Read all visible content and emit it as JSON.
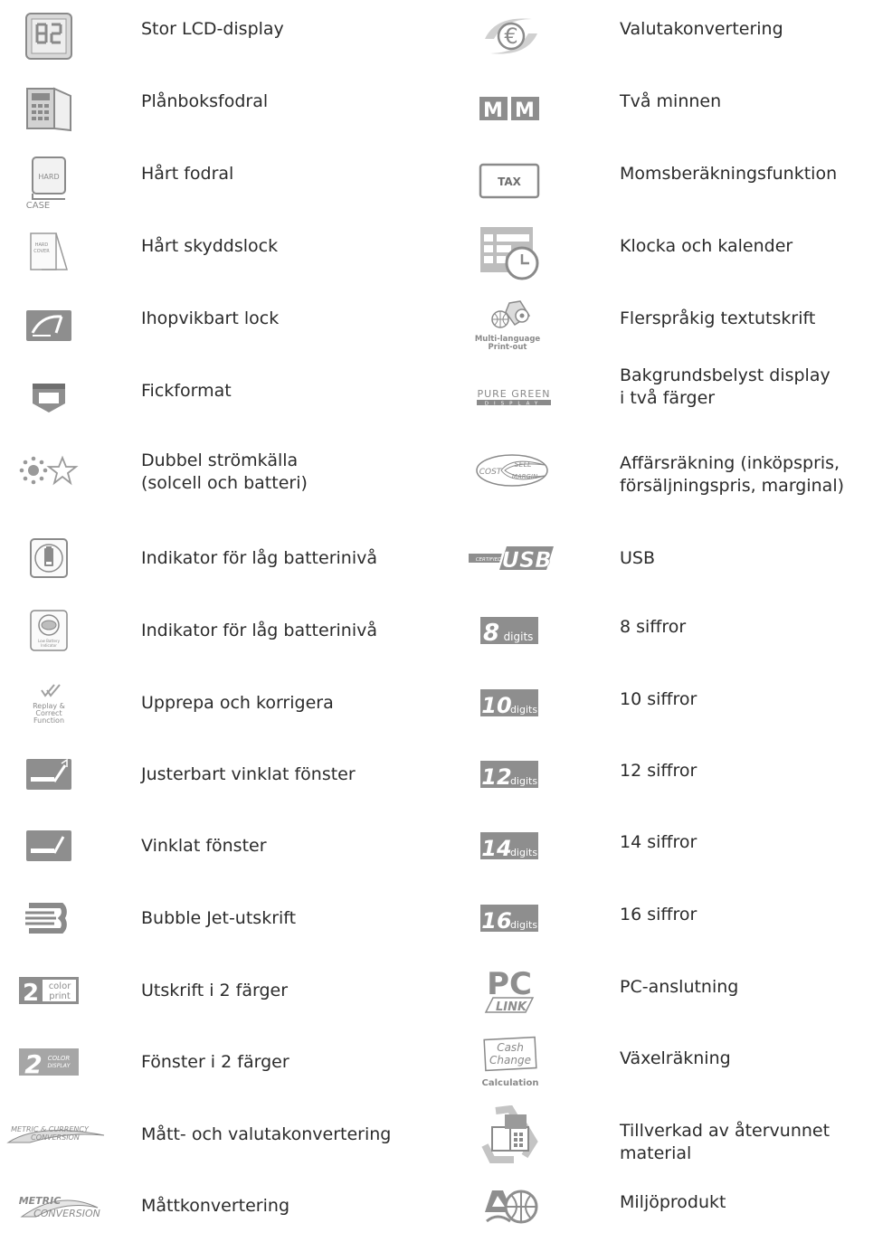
{
  "left_column": [
    {
      "label": "Stor LCD-display",
      "icon": "large-lcd-display-icon"
    },
    {
      "label": "Plånboksfodral",
      "icon": "wallet-case-icon"
    },
    {
      "label": "Hårt fodral",
      "icon": "hard-case-icon",
      "icon_text": [
        "HARD",
        "CASE"
      ]
    },
    {
      "label": "Hårt skyddslock",
      "icon": "hard-cover-icon",
      "icon_text": [
        "HARD",
        "COVER"
      ]
    },
    {
      "label": "Ihopvikbart lock",
      "icon": "folding-cover-icon"
    },
    {
      "label": "Fickformat",
      "icon": "pocket-size-icon"
    },
    {
      "label": "Dubbel strömkälla\n(solcell och batteri)",
      "icon": "dual-power-icon"
    },
    {
      "label": "Indikator för låg batterinivå",
      "icon": "low-battery-indicator-icon"
    },
    {
      "label": "Indikator för låg batterinivå",
      "icon": "low-battery-indicator-alt-icon",
      "icon_text": [
        "Low Battery",
        "Indicator"
      ]
    },
    {
      "label": "Upprepa och korrigera",
      "icon": "replay-correct-icon",
      "icon_text": [
        "Replay &",
        "Correct",
        "Function"
      ]
    },
    {
      "label": "Justerbart vinklat fönster",
      "icon": "adjustable-tilt-display-icon"
    },
    {
      "label": "Vinklat fönster",
      "icon": "tilted-display-icon"
    },
    {
      "label": "Bubble Jet-utskrift",
      "icon": "bubble-jet-print-icon"
    },
    {
      "label": "Utskrift i 2 färger",
      "icon": "two-color-print-icon",
      "icon_text": [
        "2",
        "color",
        "print"
      ]
    },
    {
      "label": "Fönster i 2 färger",
      "icon": "two-color-display-icon",
      "icon_text": [
        "2",
        "COLOR",
        "DISPLAY"
      ]
    },
    {
      "label": "Mått- och valutakonvertering",
      "icon": "metric-currency-conversion-icon",
      "icon_text": [
        "METRIC & CURRENCY",
        "CONVERSION"
      ]
    },
    {
      "label": "Måttkonvertering",
      "icon": "metric-conversion-icon",
      "icon_text": [
        "METRIC",
        "CONVERSION"
      ]
    }
  ],
  "right_column": [
    {
      "label": "Valutakonvertering",
      "icon": "euro-conversion-icon"
    },
    {
      "label": "Två minnen",
      "icon": "two-memories-icon",
      "icon_text": [
        "M",
        "M"
      ]
    },
    {
      "label": "Momsberäkningsfunktion",
      "icon": "tax-icon",
      "icon_text": [
        "TAX"
      ]
    },
    {
      "label": "Klocka och kalender",
      "icon": "clock-calendar-icon"
    },
    {
      "label": "Flerspråkig textutskrift",
      "icon": "multi-language-print-icon",
      "icon_text": [
        "Multi-language",
        "Print-out"
      ]
    },
    {
      "label": "Bakgrundsbelyst display\ni två färger",
      "icon": "pure-green-display-icon",
      "icon_text": [
        "PURE GREEN",
        "DISPLAY"
      ]
    },
    {
      "label": "Affärsräkning (inköpspris,\nförsäljningspris, marginal)",
      "icon": "cost-sell-margin-icon",
      "icon_text": [
        "COST",
        "SELL",
        "MARGIN"
      ]
    },
    {
      "label": "USB",
      "icon": "usb-icon",
      "icon_text": [
        "CERTIFIED",
        "USB"
      ]
    },
    {
      "label": "8 siffror",
      "icon": "eight-digits-icon",
      "icon_text": [
        "8",
        "digits"
      ]
    },
    {
      "label": "10 siffror",
      "icon": "ten-digits-icon",
      "icon_text": [
        "10",
        "digits"
      ]
    },
    {
      "label": "12 siffror",
      "icon": "twelve-digits-icon",
      "icon_text": [
        "12",
        "digits"
      ]
    },
    {
      "label": "14 siffror",
      "icon": "fourteen-digits-icon",
      "icon_text": [
        "14",
        "digits"
      ]
    },
    {
      "label": "16 siffror",
      "icon": "sixteen-digits-icon",
      "icon_text": [
        "16",
        "digits"
      ]
    },
    {
      "label": "PC-anslutning",
      "icon": "pc-link-icon",
      "icon_text": [
        "PC",
        "LINK"
      ]
    },
    {
      "label": "Växelräkning",
      "icon": "cash-change-icon",
      "icon_text": [
        "Cash",
        "Change",
        "Calculation"
      ]
    },
    {
      "label": "Tillverkad av återvunnet material",
      "icon": "recycled-material-icon"
    },
    {
      "label": "Miljöprodukt",
      "icon": "eco-product-icon"
    }
  ]
}
